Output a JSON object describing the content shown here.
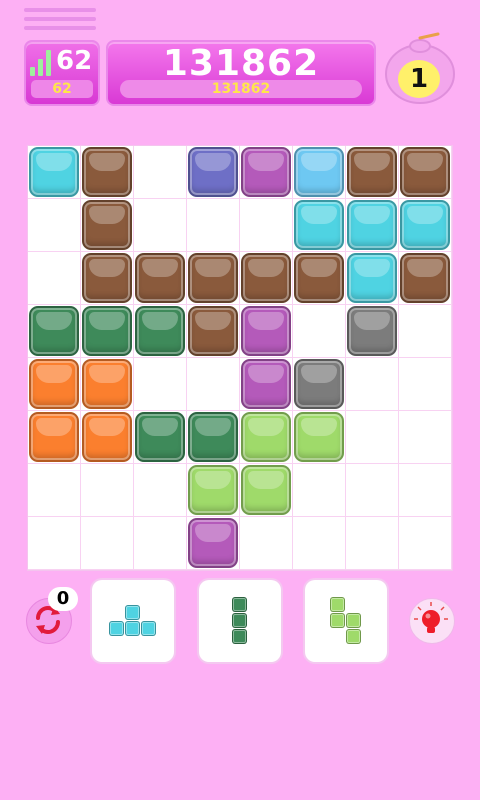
{
  "header": {
    "level": "62",
    "level_sub": "62",
    "score": "131862",
    "best_score": "131862",
    "potion_count": "1"
  },
  "board": {
    "rows": 8,
    "cols": 8,
    "grid": [
      [
        "cyan",
        "brown",
        null,
        "indigo",
        "purple",
        "sky",
        "brown",
        "brown"
      ],
      [
        null,
        "brown",
        null,
        null,
        null,
        "cyan",
        "cyan",
        "cyan"
      ],
      [
        null,
        "brown",
        "brown",
        "brown",
        "brown",
        "brown",
        "cyan",
        "brown"
      ],
      [
        "darkgreen",
        "darkgreen",
        "darkgreen",
        "brown",
        "purple",
        null,
        "gray",
        null
      ],
      [
        "orange",
        "orange",
        null,
        null,
        "purple",
        "gray",
        null,
        null
      ],
      [
        "orange",
        "orange",
        "darkgreen",
        "darkgreen",
        "lime",
        "lime",
        null,
        null
      ],
      [
        null,
        null,
        null,
        "lime",
        "lime",
        null,
        null,
        null
      ],
      [
        null,
        null,
        null,
        "purple",
        null,
        null,
        null,
        null
      ]
    ]
  },
  "colors": {
    "cyan": "#4fd3e2",
    "brown": "#8a5a3c",
    "indigo": "#6e6fc6",
    "purple": "#b45aba",
    "sky": "#6ec8f2",
    "darkgreen": "#3e8a5a",
    "orange": "#fb7f2e",
    "gray": "#7c7c7c",
    "lime": "#9fda6a"
  },
  "controls": {
    "refresh_count": "0",
    "refresh_icon": "refresh-icon",
    "hint_icon": "lightbulb-icon"
  },
  "pieces": [
    {
      "color": "cyan",
      "cells": [
        [
          0,
          1
        ],
        [
          1,
          0
        ],
        [
          1,
          1
        ],
        [
          1,
          2
        ]
      ]
    },
    {
      "color": "darkgreen",
      "cells": [
        [
          0,
          0
        ],
        [
          1,
          0
        ],
        [
          2,
          0
        ]
      ]
    },
    {
      "color": "lime",
      "cells": [
        [
          0,
          0
        ],
        [
          1,
          0
        ],
        [
          1,
          1
        ],
        [
          2,
          1
        ]
      ]
    }
  ]
}
